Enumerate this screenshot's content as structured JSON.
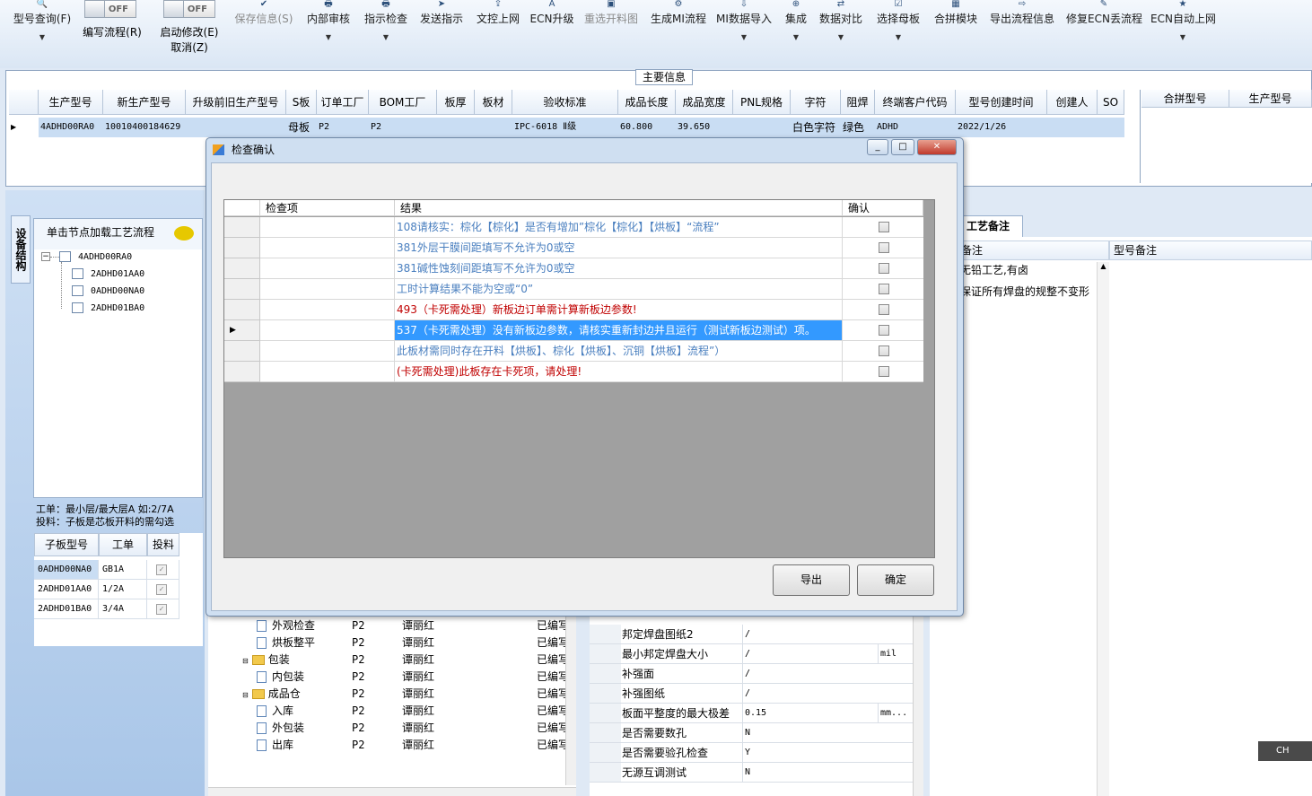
{
  "toolbar": {
    "items": [
      {
        "label": "型号查询(F)",
        "icon": "search-icon",
        "disabled": false
      },
      {
        "label": "保存信息(S)",
        "icon": "save-icon",
        "disabled": true
      },
      {
        "label": "内部审核",
        "icon": "print-icon",
        "disabled": false
      },
      {
        "label": "指示检查",
        "icon": "print-icon",
        "disabled": false
      },
      {
        "label": "发送指示",
        "icon": "send-icon",
        "disabled": false
      },
      {
        "label": "文控上网",
        "icon": "upload-icon",
        "disabled": false
      },
      {
        "label": "ECN升级",
        "icon": "font-icon",
        "disabled": false
      },
      {
        "label": "重选开料图",
        "icon": "image-icon",
        "disabled": true
      },
      {
        "label": "生成MI流程",
        "icon": "gear-icon",
        "disabled": false
      },
      {
        "label": "MI数据导入",
        "icon": "import-icon",
        "disabled": false
      },
      {
        "label": "集成",
        "icon": "merge-icon",
        "disabled": false
      },
      {
        "label": "数据对比",
        "icon": "compare-icon",
        "disabled": false
      },
      {
        "label": "选择母板",
        "icon": "select-icon",
        "disabled": false
      },
      {
        "label": "合拼模块",
        "icon": "module-icon",
        "disabled": false
      },
      {
        "label": "导出流程信息",
        "icon": "export-icon",
        "disabled": false
      },
      {
        "label": "修复ECN丢流程",
        "icon": "repair-icon",
        "disabled": false
      },
      {
        "label": "ECN自动上网",
        "icon": "star-icon",
        "disabled": false
      }
    ],
    "toggle_off": "OFF",
    "write_flow": "编写流程(R)",
    "start_modify": "启动修改(E)",
    "cancel_modify": "取消(Z)"
  },
  "main_info": {
    "section_label": "主要信息",
    "columns": [
      "生产型号",
      "新生产型号",
      "升级前旧生产型号",
      "S板",
      "订单工厂",
      "BOM工厂",
      "板厚",
      "板材",
      "验收标准",
      "成品长度",
      "成品宽度",
      "PNL规格",
      "字符",
      "阻焊",
      "终端客户代码",
      "型号创建时间",
      "创建人",
      "SO"
    ],
    "row": [
      "4ADHD00RA0",
      "10010400184629",
      "",
      "母板",
      "P2",
      "P2",
      "",
      "",
      "IPC-6018 Ⅱ级",
      "60.800",
      "39.650",
      "",
      "白色字符",
      "绿色",
      "ADHD",
      "2022/1/26",
      "",
      ""
    ],
    "right_columns": [
      "合拼型号",
      "生产型号"
    ]
  },
  "left_panel": {
    "vertical_tab": "设备结构",
    "tree_title": "单击节点加载工艺流程",
    "tree": [
      "4ADHD00RA0",
      "2ADHD01AA0",
      "0ADHD00NA0",
      "2ADHD01BA0"
    ],
    "note_line1": "工单：最小层/最大层A 如:2/7A",
    "note_line2": "投料：子板是芯板开料的需勾选",
    "sub_columns": [
      "子板型号",
      "工单",
      "投料"
    ],
    "sub_rows": [
      [
        "0ADHD00NA0",
        "GB1A"
      ],
      [
        "2ADHD01AA0",
        "1/2A"
      ],
      [
        "2ADHD01BA0",
        "3/4A"
      ]
    ]
  },
  "process_list": [
    {
      "name": "外观检查",
      "factory": "P2",
      "color": "谭丽红",
      "status": "已编写",
      "kind": "doc",
      "indent": 2
    },
    {
      "name": "烘板整平",
      "factory": "P2",
      "color": "谭丽红",
      "status": "已编写",
      "kind": "doc",
      "indent": 2
    },
    {
      "name": "包装",
      "factory": "P2",
      "color": "谭丽红",
      "status": "已编写",
      "kind": "folder",
      "indent": 1
    },
    {
      "name": "内包装",
      "factory": "P2",
      "color": "谭丽红",
      "status": "已编写",
      "kind": "doc",
      "indent": 2
    },
    {
      "name": "成品仓",
      "factory": "P2",
      "color": "谭丽红",
      "status": "已编写",
      "kind": "folder",
      "indent": 1
    },
    {
      "name": "入库",
      "factory": "P2",
      "color": "谭丽红",
      "status": "已编写",
      "kind": "doc",
      "indent": 2
    },
    {
      "name": "外包装",
      "factory": "P2",
      "color": "谭丽红",
      "status": "已编写",
      "kind": "doc",
      "indent": 2
    },
    {
      "name": "出库",
      "factory": "P2",
      "color": "谭丽红",
      "status": "已编写",
      "kind": "doc",
      "indent": 2
    }
  ],
  "properties": [
    {
      "label": "邦定焊盘图纸2",
      "value": "/",
      "unit": ""
    },
    {
      "label": "最小邦定焊盘大小",
      "value": "/",
      "unit": "mil"
    },
    {
      "label": "补强面",
      "value": "/",
      "unit": ""
    },
    {
      "label": "补强图纸",
      "value": "/",
      "unit": ""
    },
    {
      "label": "板面平整度的最大极差",
      "value": "0.15",
      "unit": "mm..."
    },
    {
      "label": "是否需要数孔",
      "value": "N",
      "unit": ""
    },
    {
      "label": "是否需要验孔检查",
      "value": "Y",
      "unit": ""
    },
    {
      "label": "无源互调测试",
      "value": "N",
      "unit": ""
    }
  ],
  "right_panel": {
    "tab": "工艺备注",
    "col1": "备注",
    "col2": "型号备注",
    "note1": "无铅工艺,有卤",
    "note2": "保证所有焊盘的规整不变形"
  },
  "dialog": {
    "title": "检查确认",
    "columns": [
      "检查项",
      "结果",
      "确认"
    ],
    "rows": [
      {
        "result": "108请核实：棕化【棕化】是否有增加”棕化【棕化】【烘板】“流程”",
        "style": "blue"
      },
      {
        "result": "381外层干膜间距填写不允许为0或空",
        "style": "blue"
      },
      {
        "result": "381碱性蚀刻间距填写不允许为0或空",
        "style": "blue"
      },
      {
        "result": "工时计算结果不能为空或“0”",
        "style": "blue"
      },
      {
        "result": "493（卡死需处理）新板边订单需计算新板边参数!",
        "style": "red"
      },
      {
        "result": "537（卡死需处理）没有新板边参数，请核实重新封边并且运行（测试新板边测试）项。",
        "style": "sel"
      },
      {
        "result": "此板材需同时存在开料【烘板】、棕化【烘板】、沉铜【烘板】流程”）",
        "style": "blue"
      },
      {
        "result": "(卡死需处理)此板存在卡死项，请处理!",
        "style": "red"
      }
    ],
    "export_button": "导出",
    "ok_button": "确定"
  },
  "ime": "CH"
}
